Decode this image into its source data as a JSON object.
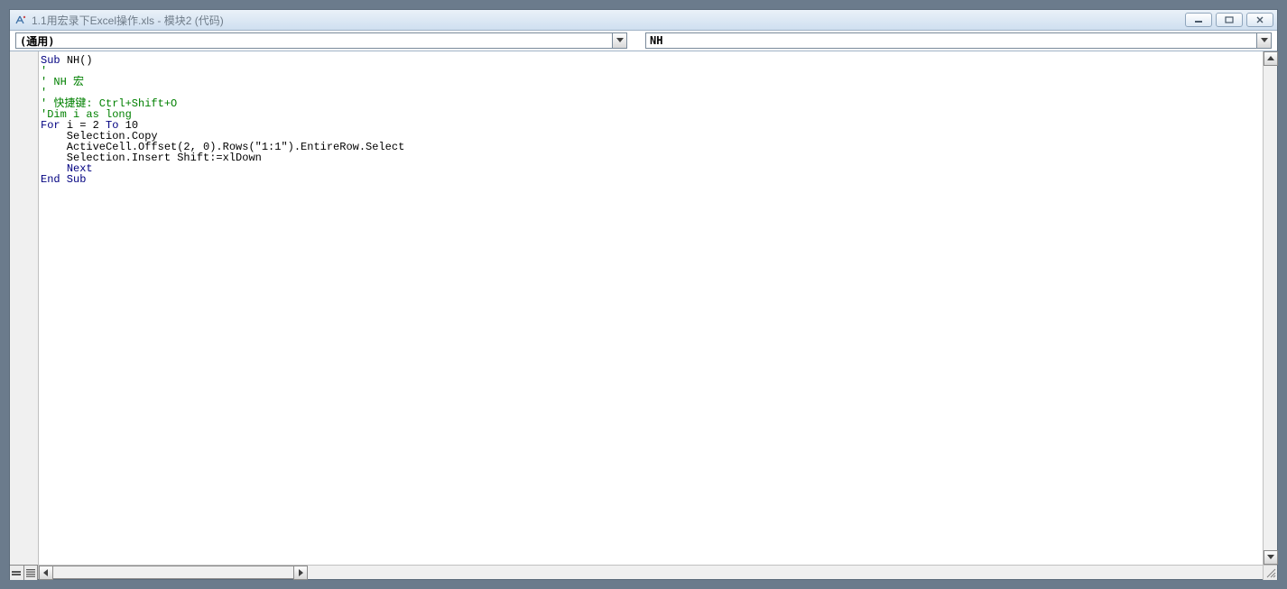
{
  "window": {
    "title": "1.1用宏录下Excel操作.xls - 模块2 (代码)"
  },
  "selectors": {
    "object": "(通用)",
    "procedure": "NH"
  },
  "code": {
    "lines": [
      {
        "t": "kw",
        "s": "Sub "
      },
      {
        "t": "",
        "s": "NH()\n"
      },
      {
        "t": "cm",
        "s": "'\n"
      },
      {
        "t": "cm",
        "s": "' NH 宏\n"
      },
      {
        "t": "cm",
        "s": "'\n"
      },
      {
        "t": "cm",
        "s": "' 快捷键: Ctrl+Shift+O\n"
      },
      {
        "t": "cm",
        "s": "'Dim i as long\n"
      },
      {
        "t": "kw",
        "s": "For "
      },
      {
        "t": "",
        "s": "i = 2 "
      },
      {
        "t": "kw",
        "s": "To "
      },
      {
        "t": "",
        "s": "10\n"
      },
      {
        "t": "",
        "s": "    Selection.Copy\n"
      },
      {
        "t": "",
        "s": "    ActiveCell.Offset(2, 0).Rows(\"1:1\").EntireRow.Select\n"
      },
      {
        "t": "",
        "s": "    Selection.Insert Shift:=xlDown\n"
      },
      {
        "t": "",
        "s": "    "
      },
      {
        "t": "kw",
        "s": "Next\n"
      },
      {
        "t": "kw",
        "s": "End Sub"
      }
    ]
  }
}
